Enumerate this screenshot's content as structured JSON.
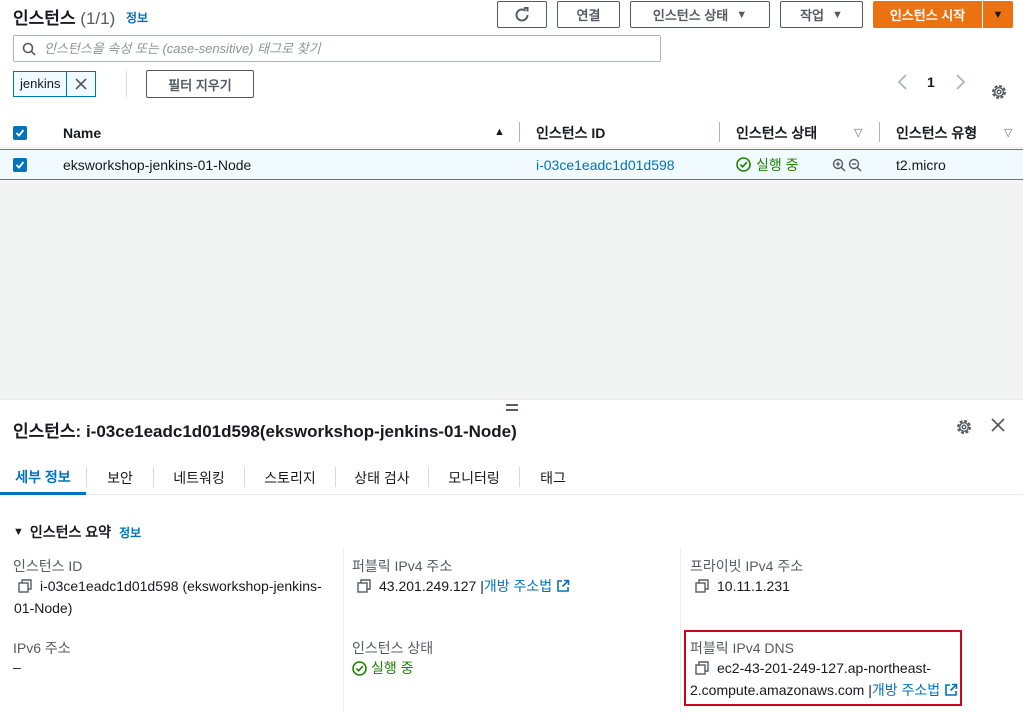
{
  "header": {
    "title": "인스턴스",
    "count": "(1/1)",
    "info": "정보",
    "connect_label": "연결",
    "state_label": "인스턴스 상태",
    "actions_label": "작업",
    "launch_label": "인스턴스 시작"
  },
  "search": {
    "placeholder": "인스턴스을 속성 또는 (case-sensitive) 태그로 찾기"
  },
  "filter": {
    "token": "jenkins",
    "clear_label": "필터 지우기"
  },
  "pager": {
    "page": "1"
  },
  "table": {
    "columns": [
      "Name",
      "인스턴스 ID",
      "인스턴스 상태",
      "인스턴스 유형"
    ],
    "row": {
      "name": "eksworkshop-jenkins-01-Node",
      "instance_id": "i-03ce1eadc1d01d598",
      "state": "실행 중",
      "type": "t2.micro"
    }
  },
  "detail": {
    "title": "인스턴스: i-03ce1eadc1d01d598(eksworkshop-jenkins-01-Node)",
    "tabs": [
      "세부 정보",
      "보안",
      "네트워킹",
      "스토리지",
      "상태 검사",
      "모니터링",
      "태그"
    ],
    "section": "인스턴스 요약",
    "section_info": "정보",
    "fields": {
      "instance_id_label": "인스턴스 ID",
      "instance_id_value_1": "i-03ce1eadc1d01d598 (eksworkshop-jenkins-",
      "instance_id_value_2": "01-Node)",
      "public_ip_label": "퍼블릭 IPv4 주소",
      "public_ip_value": "43.201.249.127 |",
      "public_ip_link": "개방 주소법",
      "private_ip_label": "프라이빗 IPv4 주소",
      "private_ip_value": "10.11.1.231",
      "ipv6_label": "IPv6 주소",
      "ipv6_value": "–",
      "state_label": "인스턴스 상태",
      "state_value": "실행 중",
      "public_dns_label": "퍼블릭 IPv4 DNS",
      "public_dns_value_1": "ec2-43-201-249-127.ap-northeast-",
      "public_dns_value_2": "2.compute.amazonaws.com |",
      "public_dns_link": "개방 주소법"
    }
  },
  "colors": {
    "accent": "#0073bb",
    "primary": "#ec7211",
    "success": "#1d8102",
    "highlight": "#d0021b"
  }
}
